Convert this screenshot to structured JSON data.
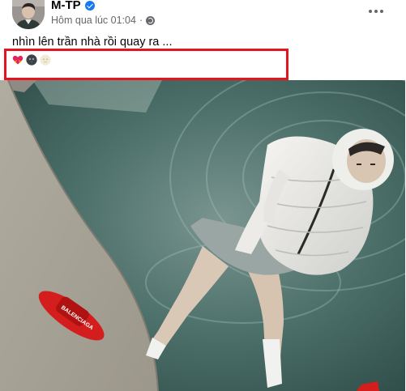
{
  "post": {
    "author_name": "M-TP",
    "timestamp": "Hôm qua lúc 01:04",
    "privacy_icon": "globe-icon",
    "verified_icon": "verified-badge-icon",
    "more_icon": "more-options-icon",
    "caption": "nhìn lên trần nhà rồi quay ra ...",
    "emojis": [
      "heart-ribbon-emoji",
      "new-moon-face-emoji",
      "full-moon-face-emoji"
    ],
    "highlight_color": "#e3151f",
    "accent_color": "#1877f2"
  }
}
